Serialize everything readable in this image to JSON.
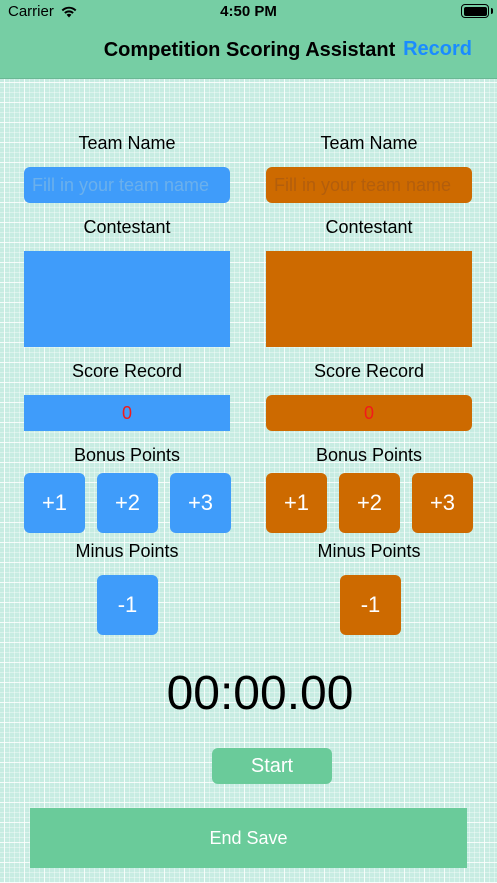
{
  "status_bar": {
    "carrier": "Carrier",
    "time": "4:50 PM"
  },
  "nav": {
    "title": "Competition Scoring Assistant",
    "record_label": "Record"
  },
  "colors": {
    "team_left": "#3f9cfa",
    "team_right": "#cd6a00",
    "accent": "#6acb9a",
    "score_text": "#f21a1a",
    "header": "#76cea4"
  },
  "teams": [
    {
      "team_name_label": "Team Name",
      "team_name_placeholder": "Fill in your team name",
      "team_name_value": "",
      "contestant_label": "Contestant",
      "score_label": "Score Record",
      "score_value": "0",
      "bonus_label": "Bonus Points",
      "bonus_buttons": [
        "+1",
        "+2",
        "+3"
      ],
      "minus_label": "Minus Points",
      "minus_buttons": [
        "-1"
      ]
    },
    {
      "team_name_label": "Team Name",
      "team_name_placeholder": "Fill in your team name",
      "team_name_value": "",
      "contestant_label": "Contestant",
      "score_label": "Score Record",
      "score_value": "0",
      "bonus_label": "Bonus Points",
      "bonus_buttons": [
        "+1",
        "+2",
        "+3"
      ],
      "minus_label": "Minus Points",
      "minus_buttons": [
        "-1"
      ]
    }
  ],
  "timer": {
    "display": "00:00.00",
    "start_label": "Start"
  },
  "footer": {
    "end_save_label": "End Save"
  },
  "icons": {
    "signal": "wifi-icon",
    "battery": "battery-icon"
  }
}
